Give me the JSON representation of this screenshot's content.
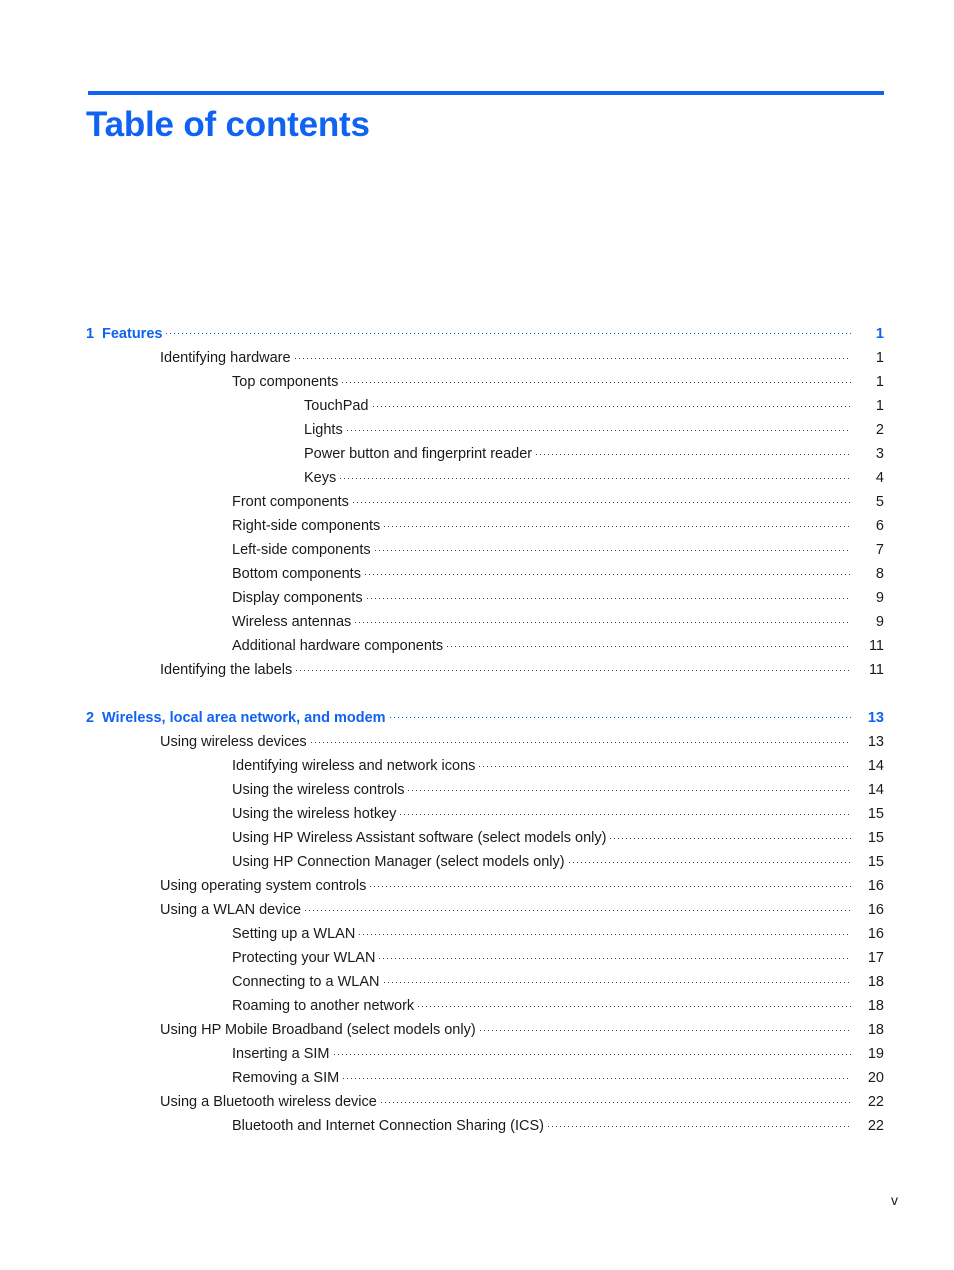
{
  "page": {
    "title": "Table of contents",
    "folio": "v",
    "accent_color": "#0f62f2",
    "text_color": "#1a1a1a"
  },
  "toc": {
    "entries": [
      {
        "level": "chapter",
        "number": "1",
        "label": "Features",
        "page": "1"
      },
      {
        "level": "1",
        "label": "Identifying hardware",
        "page": "1"
      },
      {
        "level": "2",
        "label": "Top components",
        "page": "1"
      },
      {
        "level": "3",
        "label": "TouchPad",
        "page": "1"
      },
      {
        "level": "3",
        "label": "Lights",
        "page": "2"
      },
      {
        "level": "3",
        "label": "Power button and fingerprint reader",
        "page": "3"
      },
      {
        "level": "3",
        "label": "Keys",
        "page": "4"
      },
      {
        "level": "2",
        "label": "Front components",
        "page": "5"
      },
      {
        "level": "2",
        "label": "Right-side components",
        "page": "6"
      },
      {
        "level": "2",
        "label": "Left-side components",
        "page": "7"
      },
      {
        "level": "2",
        "label": "Bottom components",
        "page": "8"
      },
      {
        "level": "2",
        "label": "Display components ",
        "page": "9"
      },
      {
        "level": "2",
        "label": "Wireless antennas",
        "page": "9"
      },
      {
        "level": "2",
        "label": "Additional hardware components",
        "page": "11"
      },
      {
        "level": "1",
        "label": "Identifying the labels",
        "page": "11"
      },
      {
        "level": "spacer"
      },
      {
        "level": "chapter",
        "number": "2",
        "label": "Wireless, local area network, and modem",
        "page": "13"
      },
      {
        "level": "1",
        "label": "Using wireless devices",
        "page": "13"
      },
      {
        "level": "2",
        "label": "Identifying wireless and network icons",
        "page": "14"
      },
      {
        "level": "2",
        "label": "Using the wireless controls",
        "page": "14"
      },
      {
        "level": "2",
        "label": "Using the wireless hotkey",
        "page": "15"
      },
      {
        "level": "2",
        "label": "Using HP Wireless Assistant software (select models only)",
        "page": "15"
      },
      {
        "level": "2",
        "label": "Using HP Connection Manager (select models only)",
        "page": "15"
      },
      {
        "level": "1",
        "label": "Using operating system controls",
        "page": "16"
      },
      {
        "level": "1",
        "label": "Using a WLAN device",
        "page": "16"
      },
      {
        "level": "2",
        "label": "Setting up a WLAN",
        "page": "16"
      },
      {
        "level": "2",
        "label": "Protecting your WLAN",
        "page": "17"
      },
      {
        "level": "2",
        "label": "Connecting to a WLAN",
        "page": "18"
      },
      {
        "level": "2",
        "label": "Roaming to another network",
        "page": "18"
      },
      {
        "level": "1",
        "label": "Using HP Mobile Broadband (select models only)",
        "page": "18"
      },
      {
        "level": "2",
        "label": "Inserting a SIM",
        "page": "19"
      },
      {
        "level": "2",
        "label": "Removing a SIM",
        "page": "20"
      },
      {
        "level": "1",
        "label": "Using a Bluetooth wireless device",
        "page": "22"
      },
      {
        "level": "2",
        "label": "Bluetooth and Internet Connection Sharing (ICS)",
        "page": "22"
      }
    ]
  }
}
